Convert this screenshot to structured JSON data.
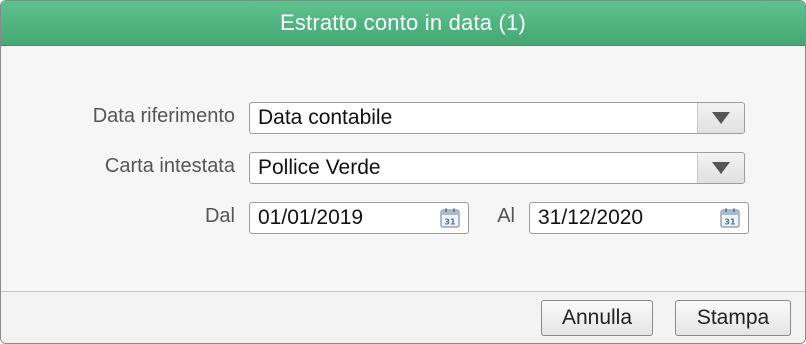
{
  "dialog": {
    "title": "Estratto conto in data (1)"
  },
  "form": {
    "data_riferimento": {
      "label": "Data riferimento",
      "value": "Data contabile"
    },
    "carta_intestata": {
      "label": "Carta intestata",
      "value": "Pollice Verde"
    },
    "dal": {
      "label": "Dal",
      "value": "01/01/2019"
    },
    "al": {
      "label": "Al",
      "value": "31/12/2020"
    }
  },
  "buttons": {
    "cancel": "Annulla",
    "print": "Stampa"
  },
  "icons": {
    "dropdown": "chevron-down-icon",
    "calendar": "calendar-icon"
  },
  "colors": {
    "titlebar": "#4fb582",
    "title_text": "#ffffff"
  }
}
